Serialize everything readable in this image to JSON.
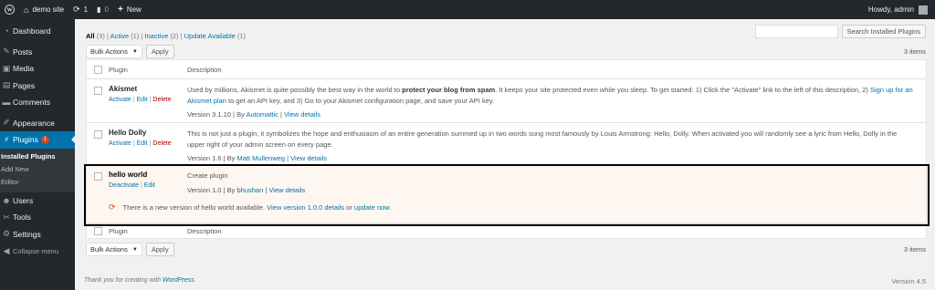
{
  "adminbar": {
    "site_name": "demo site",
    "updates_count": "1",
    "comments_count": "0",
    "new_label": "New",
    "greeting": "Howdy, admin"
  },
  "sidebar": {
    "items": [
      {
        "label": "Dashboard",
        "icon": "dashboard-icon"
      },
      {
        "label": "Posts",
        "icon": "pin-icon"
      },
      {
        "label": "Media",
        "icon": "media-icon"
      },
      {
        "label": "Pages",
        "icon": "page-icon"
      },
      {
        "label": "Comments",
        "icon": "comment-icon"
      },
      {
        "label": "Appearance",
        "icon": "brush-icon"
      },
      {
        "label": "Plugins",
        "icon": "plugin-icon",
        "badge": "1"
      },
      {
        "label": "Users",
        "icon": "users-icon"
      },
      {
        "label": "Tools",
        "icon": "wrench-icon"
      },
      {
        "label": "Settings",
        "icon": "settings-icon"
      },
      {
        "label": "Collapse menu",
        "icon": "collapse-icon"
      }
    ],
    "submenu": [
      "Installed Plugins",
      "Add New",
      "Editor"
    ]
  },
  "filters": {
    "all": "All",
    "all_count": "(3)",
    "active": "Active",
    "active_count": "(1)",
    "inactive": "Inactive",
    "inactive_count": "(2)",
    "update": "Update Available",
    "update_count": "(1)"
  },
  "search": {
    "button": "Search Installed Plugins",
    "placeholder": ""
  },
  "bulk": {
    "label": "Bulk Actions",
    "apply": "Apply",
    "items_count": "3 items"
  },
  "table": {
    "col_plugin": "Plugin",
    "col_desc": "Description",
    "rows": [
      {
        "name": "Akismet",
        "actions": [
          "Activate",
          "Edit",
          "Delete"
        ],
        "desc_pre": "Used by millions, Akismet is quite possibly the best way in the world to ",
        "desc_bold": "protect your blog from spam",
        "desc_post": ". It keeps your site protected even while you sleep. To get started: 1) Click the \"Activate\" link to the left of this description, 2) ",
        "desc_link": "Sign up for an Akismet plan",
        "desc_end": " to get an API key, and 3) Go to your Akismet configuration page, and save your API key.",
        "version": "Version 3.1.10 | By",
        "author": "Automattic",
        "details": "View details"
      },
      {
        "name": "Hello Dolly",
        "actions": [
          "Activate",
          "Edit",
          "Delete"
        ],
        "desc": "This is not just a plugin, it symbolizes the hope and enthusiasm of an entire generation summed up in two words sung most famously by Louis Armstrong: Hello, Dolly. When activated you will randomly see a lyric from Hello, Dolly in the upper right of your admin screen on every page.",
        "version": "Version 1.6 | By",
        "author": "Matt Mullenweg",
        "details": "View details"
      },
      {
        "name": "hello world",
        "actions": [
          "Deactivate",
          "Edit"
        ],
        "desc": "Create plugin",
        "version": "Version 1.0 | By",
        "author": "bhushan",
        "details": "View details",
        "update_pre": "There is a new version of hello world available.",
        "update_link1": "View version 1.0.0 details",
        "update_mid": "or",
        "update_link2": "update now",
        "update_end": "."
      }
    ]
  },
  "footer": {
    "credit_pre": "Thank you for creating with",
    "credit_link": "WordPress",
    "credit_end": ".",
    "version": "Version 4.5"
  },
  "colors": {
    "adminbar": "#23282d",
    "accent": "#0073aa",
    "badge": "#ca4a1f",
    "update_bg": "#fef7f1"
  }
}
